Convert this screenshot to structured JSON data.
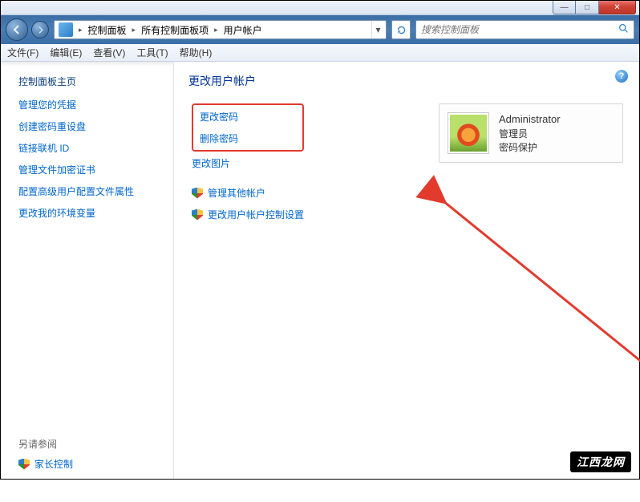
{
  "window": {
    "controls": {
      "minimize": "—",
      "maximize": "□",
      "close": "✕"
    }
  },
  "breadcrumb": {
    "segments": [
      "控制面板",
      "所有控制面板项",
      "用户帐户"
    ]
  },
  "search": {
    "placeholder": "搜索控制面板"
  },
  "menu": {
    "file": "文件(F)",
    "edit": "编辑(E)",
    "view": "查看(V)",
    "tools": "工具(T)",
    "help": "帮助(H)"
  },
  "sidebar": {
    "home": "控制面板主页",
    "links": [
      "管理您的凭据",
      "创建密码重设盘",
      "链接联机 ID",
      "管理文件加密证书",
      "配置高级用户配置文件属性",
      "更改我的环境变量"
    ],
    "see_also": "另请参阅",
    "bottom_link": "家长控制"
  },
  "main": {
    "title": "更改用户帐户",
    "primary_links": [
      "更改密码",
      "删除密码"
    ],
    "secondary_link": "更改图片",
    "shield_links": [
      "管理其他帐户",
      "更改用户帐户控制设置"
    ]
  },
  "user": {
    "name": "Administrator",
    "role": "管理员",
    "status": "密码保护"
  },
  "watermark": "江西龙网"
}
